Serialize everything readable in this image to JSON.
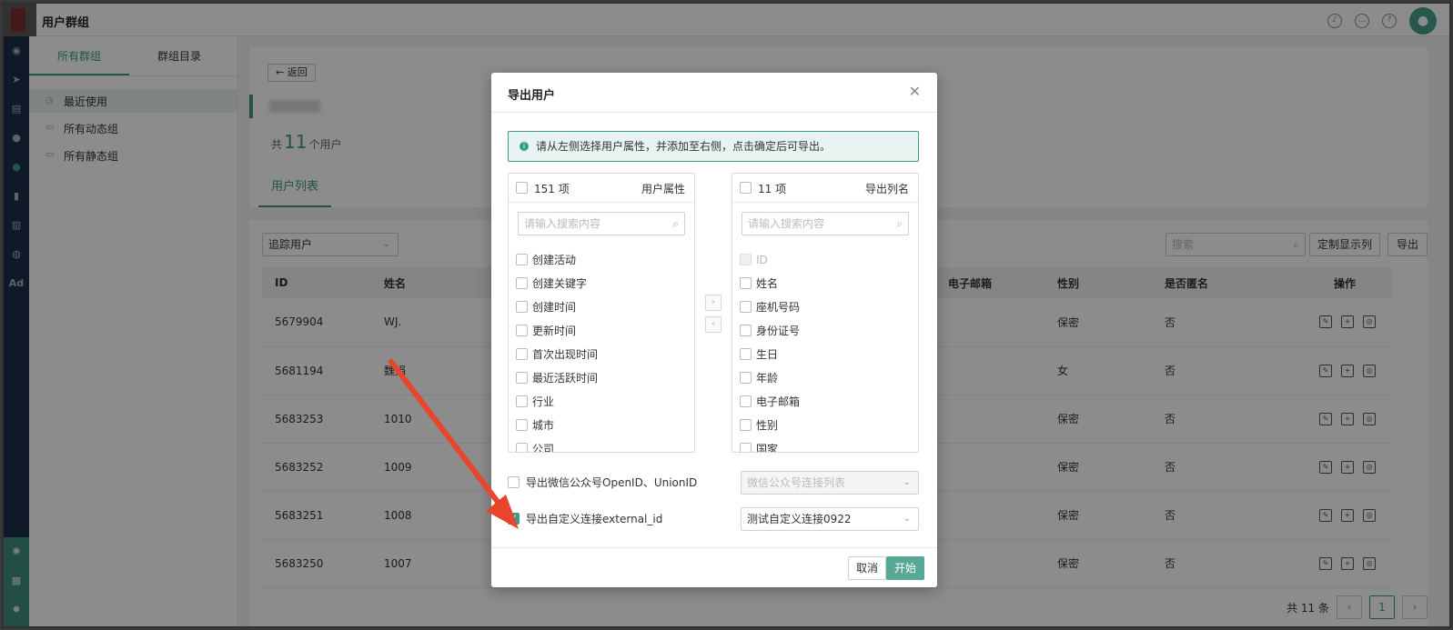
{
  "app": {
    "title": "用户群组"
  },
  "topbar": {
    "icons": [
      "bell-icon",
      "chat-icon",
      "help-icon",
      "user-avatar"
    ]
  },
  "group_sidebar": {
    "tabs": [
      "所有群组",
      "群组目录"
    ],
    "items": [
      {
        "label": "最近使用",
        "icon": "clock-icon"
      },
      {
        "label": "所有动态组",
        "icon": "folder-icon"
      },
      {
        "label": "所有静态组",
        "icon": "folder-icon"
      }
    ]
  },
  "header": {
    "back_label": "← 返回",
    "count_prefix": "共",
    "count_value": "11",
    "count_suffix": "个用户",
    "tab": "用户列表"
  },
  "toolbar": {
    "filter_value": "追踪用户",
    "search_placeholder": "搜索",
    "custom_cols_label": "定制显示列",
    "export_label": "导出"
  },
  "table": {
    "columns": [
      "ID",
      "姓名",
      "电子邮箱",
      "性别",
      "是否匿名",
      "操作"
    ],
    "rows": [
      {
        "id": "5679904",
        "name": "WJ.",
        "email": "",
        "gender": "保密",
        "anon": "否"
      },
      {
        "id": "5681194",
        "name": "魏娟",
        "email": "",
        "gender": "女",
        "anon": "否"
      },
      {
        "id": "5683253",
        "name": "1010",
        "email": "",
        "gender": "保密",
        "anon": "否"
      },
      {
        "id": "5683252",
        "name": "1009",
        "email": "",
        "gender": "保密",
        "anon": "否"
      },
      {
        "id": "5683251",
        "name": "1008",
        "email": "",
        "gender": "保密",
        "anon": "否"
      },
      {
        "id": "5683250",
        "name": "1007",
        "email": "",
        "gender": "保密",
        "anon": "否"
      }
    ]
  },
  "pager": {
    "total": "共 11 条",
    "current": "1",
    "prev": "‹",
    "next": "›"
  },
  "modal": {
    "title": "导出用户",
    "tip": "请从左侧选择用户属性，并添加至右侧，点击确定后可导出。",
    "left": {
      "count": "151 项",
      "title": "用户属性",
      "search_placeholder": "请输入搜索内容",
      "items": [
        "创建活动",
        "创建关键字",
        "创建时间",
        "更新时间",
        "首次出现时间",
        "最近活跃时间",
        "行业",
        "城市",
        "公司"
      ]
    },
    "right": {
      "count": "11 项",
      "title": "导出列名",
      "search_placeholder": "请输入搜索内容",
      "items": [
        "ID",
        "姓名",
        "座机号码",
        "身份证号",
        "生日",
        "年龄",
        "电子邮箱",
        "性别",
        "国家"
      ]
    },
    "arrow_right": "›",
    "arrow_left": "‹",
    "option_wechat": {
      "label": "导出微信公众号OpenID、UnionID",
      "checked": false,
      "select_placeholder": "微信公众号连接列表"
    },
    "option_custom": {
      "label": "导出自定义连接external_id",
      "checked": true,
      "select_value": "测试自定义连接0922"
    },
    "cancel_label": "取消",
    "start_label": "开始"
  },
  "colors": {
    "accent": "#3c9a85",
    "nav_bg": "#1d2e4a",
    "annotation_arrow": "#e8452c"
  }
}
